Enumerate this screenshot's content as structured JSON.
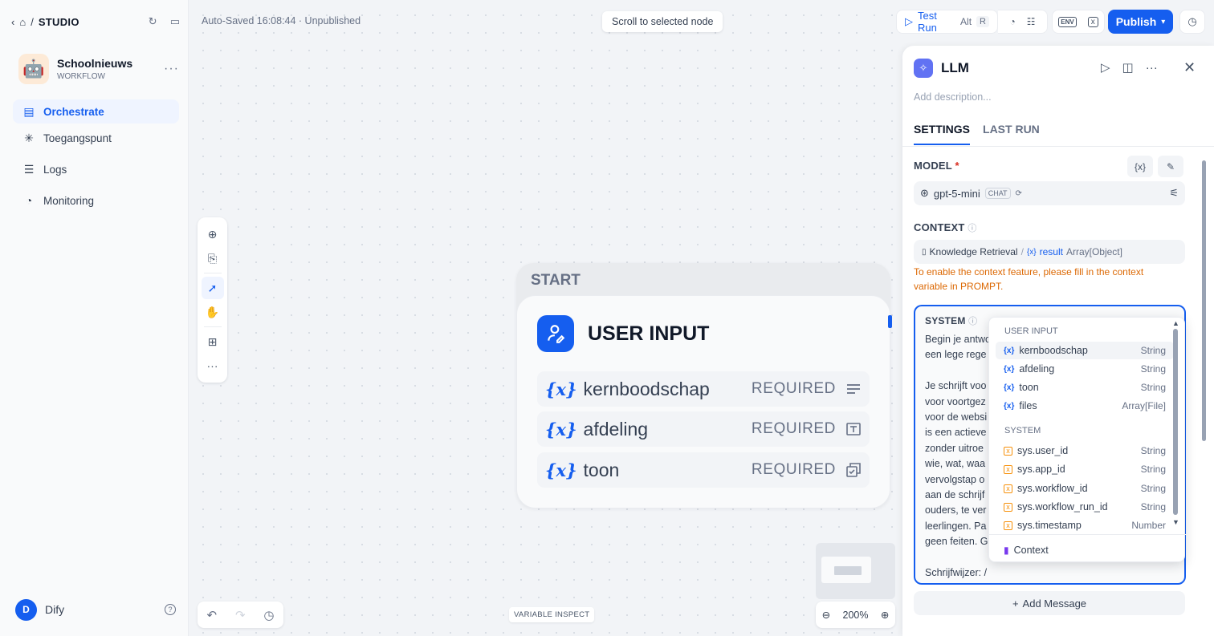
{
  "sidebar": {
    "title": "STUDIO",
    "app": {
      "name": "Schoolnieuws",
      "type": "WORKFLOW",
      "emoji": "🤖"
    },
    "nav": [
      {
        "label": "Orchestrate",
        "icon": "orchestrate-icon",
        "active": true
      },
      {
        "label": "Toegangspunt",
        "icon": "access-icon"
      },
      {
        "label": "Logs",
        "icon": "logs-icon"
      },
      {
        "label": "Monitoring",
        "icon": "monitoring-icon"
      }
    ],
    "user": {
      "initial": "D",
      "name": "Dify"
    }
  },
  "canvas": {
    "autosave": "Auto-Saved 16:08:44 · Unpublished",
    "scroll_button": "Scroll to selected node",
    "variable_inspect": "VARIABLE INSPECT",
    "zoom": "200%",
    "start_node": {
      "label": "START",
      "title": "USER INPUT",
      "fields": [
        {
          "name": "kernboodschap",
          "required": "REQUIRED",
          "icon": "paragraph-icon"
        },
        {
          "name": "afdeling",
          "required": "REQUIRED",
          "icon": "text-input-icon"
        },
        {
          "name": "toon",
          "required": "REQUIRED",
          "icon": "select-icon"
        }
      ]
    }
  },
  "header": {
    "test_run": "Test Run",
    "shortcut_alt": "Alt",
    "shortcut_key": "R",
    "env_label": "ENV",
    "publish": "Publish"
  },
  "panel": {
    "title": "LLM",
    "description_placeholder": "Add description...",
    "tabs": [
      "SETTINGS",
      "LAST RUN"
    ],
    "model_label": "MODEL",
    "required_mark": "*",
    "model_name": "gpt-5-mini",
    "model_chip": "CHAT",
    "context_label": "CONTEXT",
    "context_source": "Knowledge Retrieval",
    "context_sep": "/",
    "context_var": "result",
    "context_type": "Array[Object]",
    "context_warning": "To enable the context feature, please fill in the context variable in PROMPT.",
    "system_label": "SYSTEM",
    "system_text": "Begin je antwo\neen lege rege\n\nJe schrijft voo\nvoor voortgez\nvoor de websi\nis een actieve\nzonder uitroe\nwie, wat, waa\nvervolgstap o\naan de schrijf\nouders, te ver\nleerlingen. Pa\ngeen feiten. G\n\nSchrijfwijzer: /",
    "add_message": "Add Message"
  },
  "dropdown": {
    "group_user": "USER INPUT",
    "user_vars": [
      {
        "name": "kernboodschap",
        "type": "String"
      },
      {
        "name": "afdeling",
        "type": "String"
      },
      {
        "name": "toon",
        "type": "String"
      },
      {
        "name": "files",
        "type": "Array[File]"
      }
    ],
    "group_system": "SYSTEM",
    "system_vars": [
      {
        "name": "sys.user_id",
        "type": "String"
      },
      {
        "name": "sys.app_id",
        "type": "String"
      },
      {
        "name": "sys.workflow_id",
        "type": "String"
      },
      {
        "name": "sys.workflow_run_id",
        "type": "String"
      },
      {
        "name": "sys.timestamp",
        "type": "Number"
      }
    ],
    "context_item": "Context"
  },
  "colors": {
    "accent": "#155eef",
    "warning": "#dc6803",
    "background": "#f2f4f7"
  }
}
